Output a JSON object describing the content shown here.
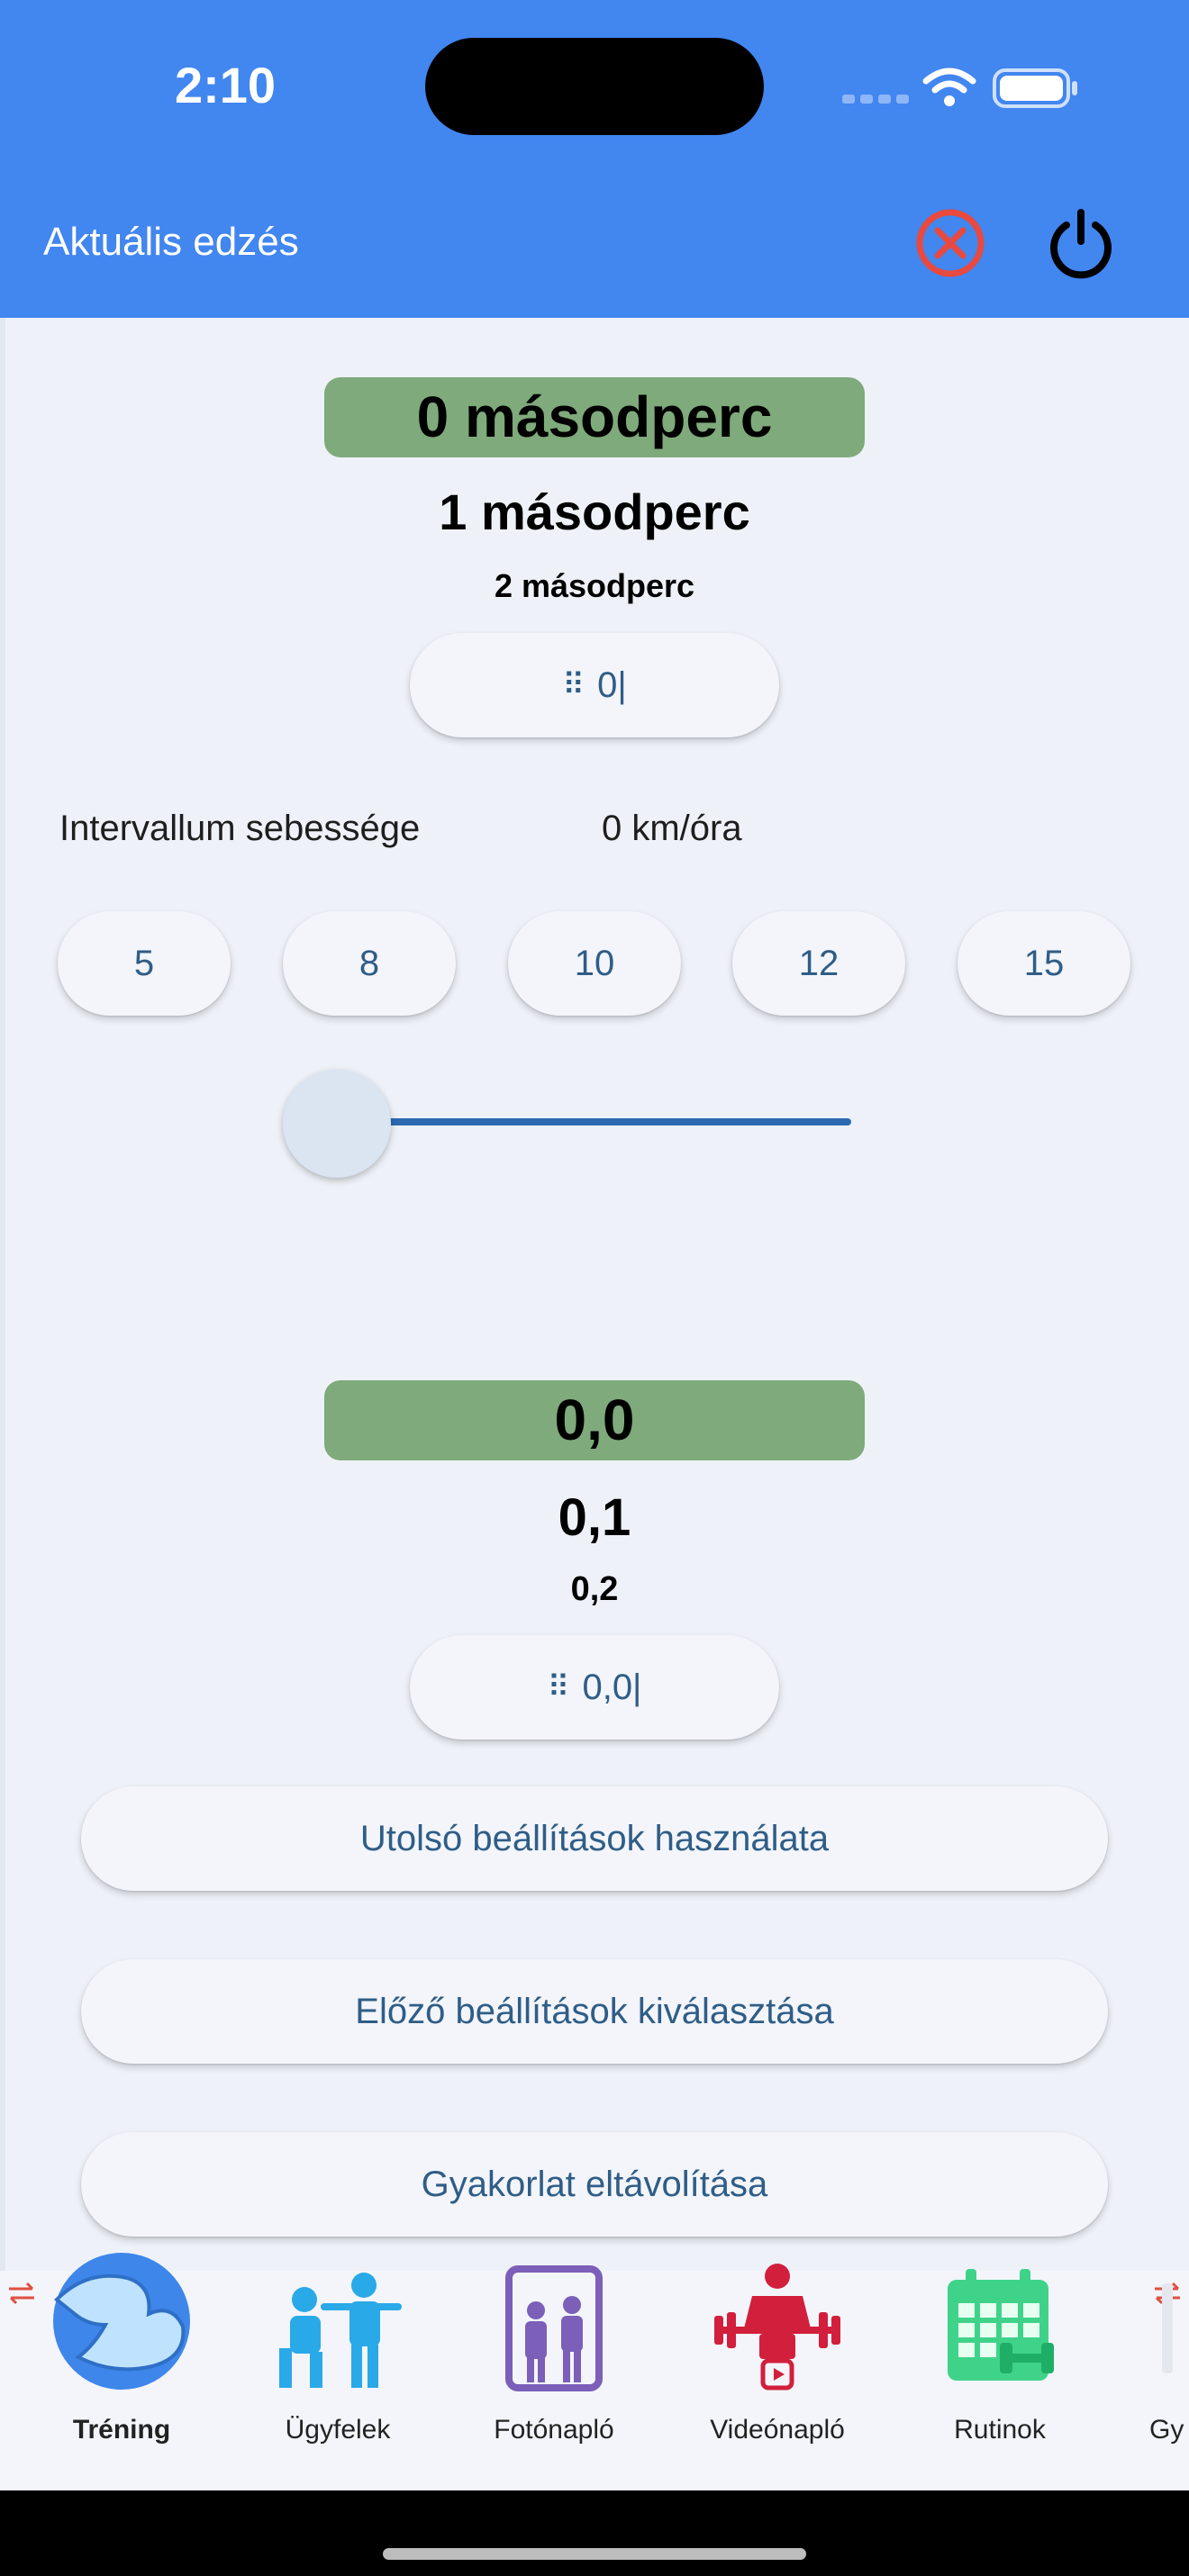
{
  "status": {
    "time": "2:10"
  },
  "appbar": {
    "title": "Aktuális edzés"
  },
  "duration_picker": {
    "selected": "0 másodperc",
    "next1": "1 másodperc",
    "next2": "2 másodperc",
    "keypad_button": "0|"
  },
  "speed": {
    "label": "Intervallum sebessége",
    "value": "0 km/óra",
    "presets": [
      "5",
      "8",
      "10",
      "12",
      "15"
    ],
    "slider_value_fraction": 0.0
  },
  "value_picker": {
    "selected": "0,0",
    "next1": "0,1",
    "next2": "0,2",
    "keypad_button": "0,0|"
  },
  "actions": {
    "use_last": "Utolsó beállítások használata",
    "select_previous": "Előző beállítások kiválasztása",
    "remove_exercise": "Gyakorlat eltávolítása"
  },
  "nav": {
    "items": [
      {
        "label": "Tréning",
        "icon": "muscle-arm-icon",
        "active": true
      },
      {
        "label": "Ügyfelek",
        "icon": "trainer-clients-icon",
        "active": false
      },
      {
        "label": "Fotónapló",
        "icon": "photo-journal-icon",
        "active": false
      },
      {
        "label": "Videónapló",
        "icon": "video-journal-icon",
        "active": false
      },
      {
        "label": "Rutinok",
        "icon": "calendar-routines-icon",
        "active": false
      },
      {
        "label": "Gy",
        "icon": "partial-item-icon",
        "active": false
      }
    ]
  },
  "colors": {
    "app_bar": "#4286f0",
    "picker_selected": "#7faa7b",
    "button_text": "#2f5d87",
    "slider_track": "#2c69b0",
    "cancel_icon": "#e84a3f"
  }
}
